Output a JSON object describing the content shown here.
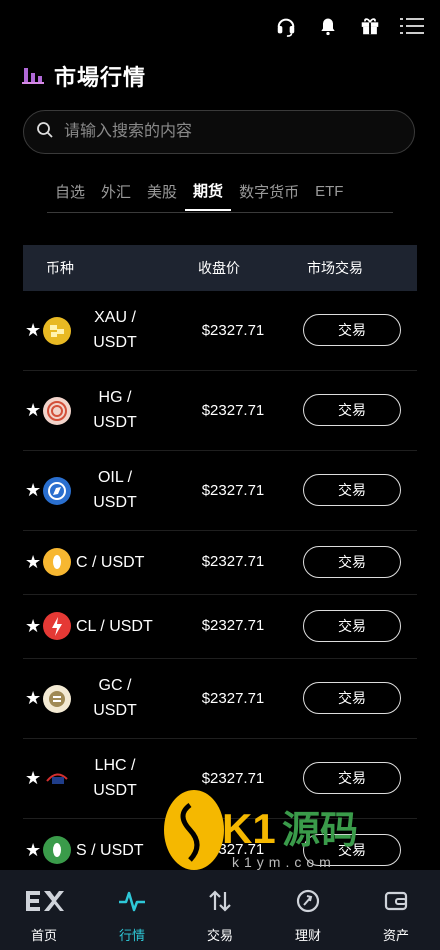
{
  "header": {
    "title": "市場行情",
    "icons": [
      "headset-icon",
      "notification-icon",
      "gift-icon",
      "menu-icon"
    ]
  },
  "search": {
    "placeholder": "请输入搜索的内容",
    "value": ""
  },
  "tabs": [
    {
      "label": "自选",
      "active": false
    },
    {
      "label": "外汇",
      "active": false
    },
    {
      "label": "美股",
      "active": false
    },
    {
      "label": "期货",
      "active": true
    },
    {
      "label": "数字货币",
      "active": false
    },
    {
      "label": "ETF",
      "active": false
    }
  ],
  "table": {
    "headers": {
      "coin": "币种",
      "price": "收盘价",
      "trade": "市场交易"
    },
    "rows": [
      {
        "name": "XAU / USDT",
        "name_line1": "XAU /",
        "name_line2": "USDT",
        "price": "$2327.71",
        "action": "交易",
        "icon": "gold-bars-icon",
        "icon_color": "#e8b923"
      },
      {
        "name": "HG / USDT",
        "name_line1": "HG /",
        "name_line2": "USDT",
        "price": "$2327.71",
        "action": "交易",
        "icon": "copper-coin-icon",
        "icon_color": "#f2d4cb"
      },
      {
        "name": "OIL / USDT",
        "name_line1": "OIL /",
        "name_line2": "USDT",
        "price": "$2327.71",
        "action": "交易",
        "icon": "compass-coin-icon",
        "icon_color": "#2a6fcf"
      },
      {
        "name": "C / USDT",
        "price": "$2327.71",
        "action": "交易",
        "icon": "corn-coin-icon",
        "icon_color": "#f7b731"
      },
      {
        "name": "CL / USDT",
        "price": "$2327.71",
        "action": "交易",
        "icon": "flame-coin-icon",
        "icon_color": "#e53935"
      },
      {
        "name": "GC / USDT",
        "name_line1": "GC /",
        "name_line2": "USDT",
        "price": "$2327.71",
        "action": "交易",
        "icon": "gc-coin-icon",
        "icon_color": "#d8c7a0"
      },
      {
        "name": "LHC / USDT",
        "name_line1": "LHC /",
        "name_line2": "USDT",
        "price": "$2327.71",
        "action": "交易",
        "icon": "lhc-logo-icon",
        "icon_color": "#1f3d8a"
      },
      {
        "name": "S / USDT",
        "price": "$2327.71",
        "action": "交易",
        "icon": "soy-coin-icon",
        "icon_color": "#3a9b4a"
      }
    ]
  },
  "nav": [
    {
      "label": "首页",
      "icon": "home-logo-icon",
      "active": false
    },
    {
      "label": "行情",
      "icon": "pulse-icon",
      "active": true
    },
    {
      "label": "交易",
      "icon": "swap-arrows-icon",
      "active": false
    },
    {
      "label": "理财",
      "icon": "at-sign-icon",
      "active": false
    },
    {
      "label": "资产",
      "icon": "wallet-icon",
      "active": false
    }
  ],
  "watermark": {
    "text": "K1源码",
    "sub": "k1ym.com"
  },
  "colors": {
    "accent": "#2ec8d8",
    "header_bg": "#1e2430",
    "nav_bg": "#151922",
    "title_icon": "#b069d6"
  }
}
